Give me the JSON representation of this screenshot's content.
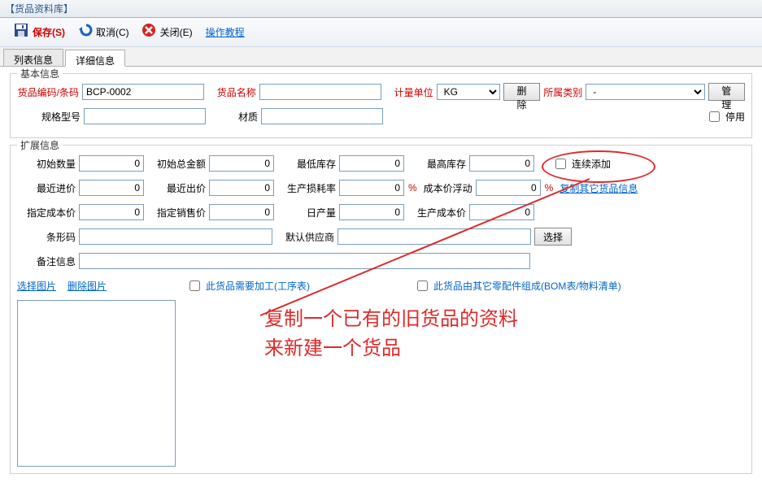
{
  "window": {
    "title": "【货品资料库】"
  },
  "toolbar": {
    "save": "保存(S)",
    "cancel": "取消(C)",
    "close": "关闭(E)",
    "tutorial": "操作教程"
  },
  "tabs": {
    "list": "列表信息",
    "detail": "详细信息"
  },
  "basic": {
    "title": "基本信息",
    "code_lbl": "货品编码/条码",
    "code_val": "BCP-0002",
    "name_lbl": "货品名称",
    "name_val": "",
    "unit_lbl": "计量单位",
    "unit_val": "KG",
    "delete_btn": "删除",
    "cat_lbl": "所属类别",
    "cat_val": "-",
    "manage_btn": "管理",
    "spec_lbl": "规格型号",
    "spec_val": "",
    "material_lbl": "材质",
    "material_val": "",
    "disable_lbl": "停用"
  },
  "ext": {
    "title": "扩展信息",
    "init_qty_lbl": "初始数量",
    "init_qty": "0",
    "init_amt_lbl": "初始总金额",
    "init_amt": "0",
    "min_stock_lbl": "最低库存",
    "min_stock": "0",
    "max_stock_lbl": "最高库存",
    "max_stock": "0",
    "cont_add_lbl": "连续添加",
    "last_buy_lbl": "最近进价",
    "last_buy": "0",
    "last_sell_lbl": "最近出价",
    "last_sell": "0",
    "loss_rate_lbl": "生产损耗率",
    "loss_rate": "0",
    "cost_float_lbl": "成本价浮动",
    "cost_float": "0",
    "copy_link": "复制其它货品信息",
    "spec_cost_lbl": "指定成本价",
    "spec_cost": "0",
    "spec_sell_lbl": "指定销售价",
    "spec_sell": "0",
    "daily_out_lbl": "日产量",
    "daily_out": "0",
    "prod_cost_lbl": "生产成本价",
    "prod_cost": "0",
    "barcode_lbl": "条形码",
    "barcode": "",
    "supplier_lbl": "默认供应商",
    "supplier": "",
    "select_btn": "选择",
    "remark_lbl": "备注信息",
    "remark": "",
    "sel_img": "选择图片",
    "del_img": "删除图片",
    "need_proc": "此货品需要加工(工序表)",
    "bom": "此货品由其它零配件组成(BOM表/物料清单)",
    "pct": "%"
  },
  "annot": {
    "line1": "复制一个已有的旧货品的资料",
    "line2": "来新建一个货品"
  }
}
